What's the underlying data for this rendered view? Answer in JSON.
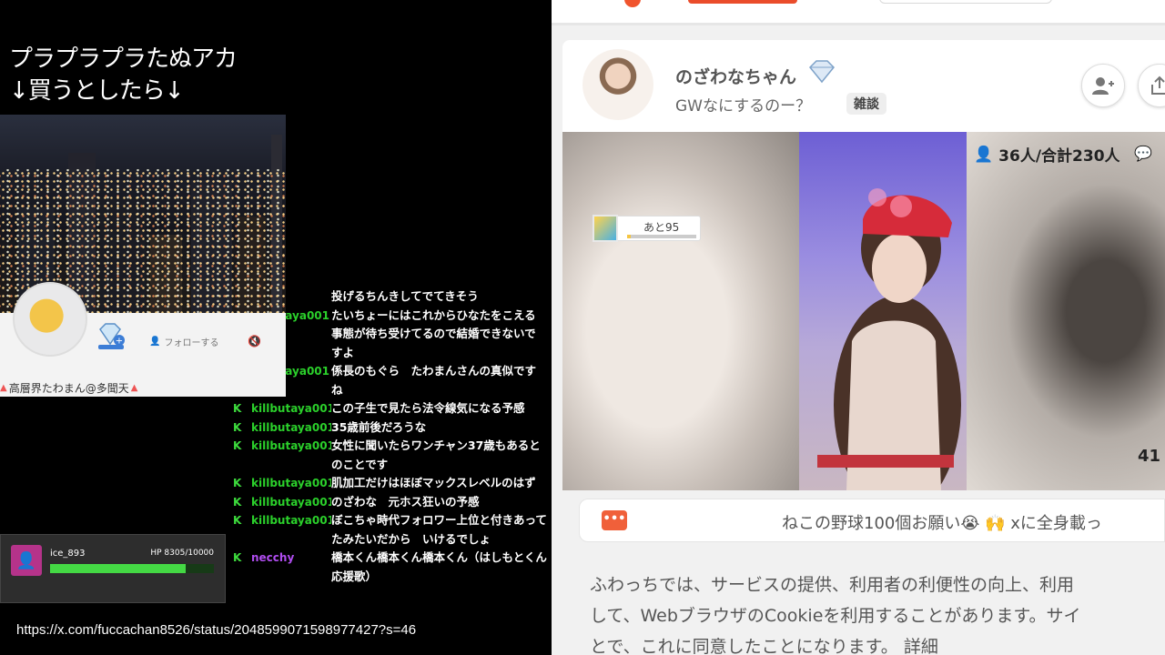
{
  "overlay": {
    "title_line1": "プラプラプラたぬアカ",
    "title_line2": "↓買うとしたら↓",
    "owner_name": "高層界たわまん@多聞天",
    "follow_label": "フォローする",
    "bottom_url": "https://x.com/fuccachan8526/status/2048599071598977427?s=46"
  },
  "chat": [
    {
      "badge": "",
      "user": "",
      "message": "投げるちんきしてでてきそう",
      "cut": true
    },
    {
      "badge": "",
      "user": "aya001",
      "message": "たいちょーにはこれからひなたをこえる事態が待ち受けてるので結婚できないですよ",
      "hidden": true
    },
    {
      "badge": "",
      "user": "aya001",
      "message": "係長のもぐら　たわまんさんの真似ですね",
      "hidden": true
    },
    {
      "badge": "K",
      "user": "killbutaya001",
      "message": "この子生で見たら法令線気になる予感"
    },
    {
      "badge": "K",
      "user": "killbutaya001",
      "message": "35歳前後だろうな"
    },
    {
      "badge": "K",
      "user": "killbutaya001",
      "message": "女性に聞いたらワンチャン37歳もあるとのことです"
    },
    {
      "badge": "K",
      "user": "killbutaya001",
      "message": "肌加工だけはほぼマックスレベルのはず"
    },
    {
      "badge": "K",
      "user": "killbutaya001",
      "message": "のざわな　元ホス狂いの予感"
    },
    {
      "badge": "K",
      "user": "killbutaya001",
      "message": "ぼこちゃ時代フォロワー上位と付きあってたみたいだから　いけるでしょ"
    },
    {
      "badge": "K",
      "user": "necchy",
      "message": "橋本くん橋本くん橋本くん（はしもとくん応援歌）",
      "purple": true
    }
  ],
  "hp_widget": {
    "username": "ice_893",
    "hp_text": "HP 8305/10000",
    "hp_fraction": 0.8305
  },
  "stream": {
    "streamer_name": "のざわなちゃん",
    "title": "GWなにするのー？",
    "tag": "雑談",
    "viewers": "36人/合計230人",
    "timer": "41",
    "goal_text": "あと95",
    "goal_fraction": 0.05,
    "banner": "ねこの野球100個お願い😭 🙌 xに全身載っ",
    "cookie_line1": "ふわっちでは、サービスの提供、利用者の利便性の向上、利用",
    "cookie_line2": "して、WebブラウザのCookieを利用することがあります。サイ",
    "cookie_line3": "とで、これに同意したことになります。",
    "cookie_detail": "詳細"
  },
  "colors": {
    "chat_user": "#2bd02b",
    "chat_user_alt": "#b04df0",
    "hp_fill": "#44d944",
    "brand": "#f0542d"
  },
  "icons": {
    "diamond": "diamond-icon",
    "add_friend": "add-friend-icon",
    "share": "share-icon",
    "viewer": "person-icon",
    "comment": "comment-icon",
    "mute": "mute-icon"
  }
}
